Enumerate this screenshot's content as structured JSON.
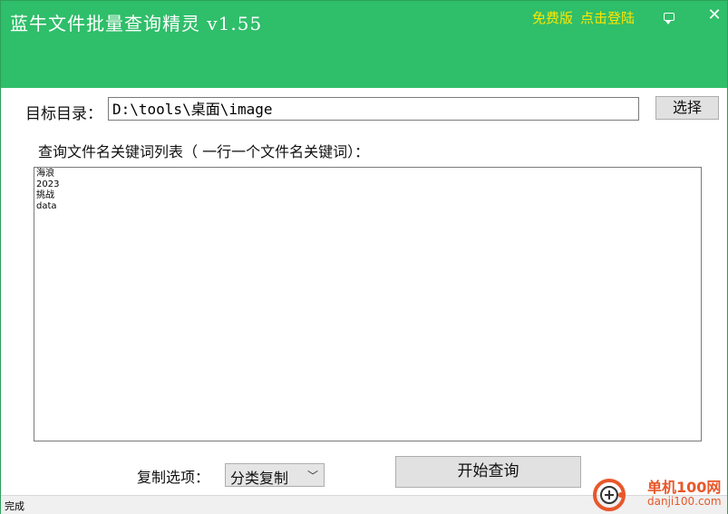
{
  "app": {
    "title": "蓝牛文件批量查询精灵 v1.55",
    "free_label": "免费版",
    "login_label": "点击登陆"
  },
  "form": {
    "target_label": "目标目录：",
    "target_value": "D:\\tools\\桌面\\image",
    "choose_button": "选择",
    "keywords_label": "查询文件名关键词列表（ 一行一个文件名关键词）：",
    "keywords": [
      "海浪",
      "2023",
      "挑战",
      "data"
    ],
    "copy_label": "复制选项：",
    "copy_option": "分类复制",
    "start_button": "开始查询"
  },
  "status": {
    "text": "完成"
  },
  "watermark": {
    "name": "单机100网",
    "url": "danji100.com"
  },
  "icons": {
    "message": "message-icon",
    "close": "close-icon",
    "dropdown": "chevron-down-icon"
  },
  "colors": {
    "header_bg": "#2fbe6a",
    "header_link": "#ffe600",
    "watermark": "#e8572a"
  }
}
